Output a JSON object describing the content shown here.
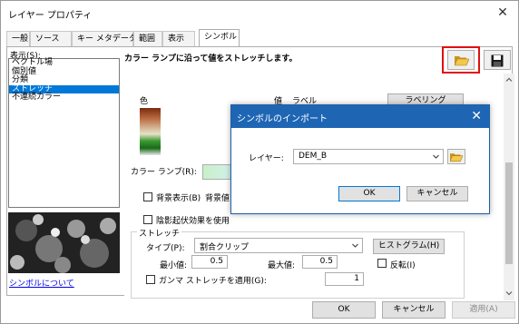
{
  "window": {
    "title": "レイヤー プロパティ",
    "close_glyph": "✕"
  },
  "tabs": [
    {
      "label": "一般"
    },
    {
      "label": "ソース"
    },
    {
      "label": "キー メタデータ"
    },
    {
      "label": "範囲"
    },
    {
      "label": "表示"
    },
    {
      "label": "シンボル"
    }
  ],
  "left": {
    "show_label": "表示(S):",
    "items": [
      "ベクトル場",
      "個別値",
      "分類",
      "ストレッチ",
      "不連続カラー"
    ],
    "selected_index": 3,
    "about_link": "シンボルについて"
  },
  "main": {
    "description": "カラー ランプに沿って値をストレッチします。",
    "import_icon": "folder-open-icon",
    "save_icon": "save-icon",
    "col_color": "色",
    "col_value": "値",
    "col_label": "ラベル",
    "labeling_button": "ラベリング",
    "color_ramp_label": "カラー ランプ(R):",
    "bg_checkbox_label": "背景表示(B)",
    "bg_value_label": "背景値",
    "hillshade_label": "陰影起伏効果を使用",
    "stretch_section": "ストレッチ",
    "type_label": "タイプ(P):",
    "type_value": "割合クリップ",
    "histogram_button": "ヒストグラム(H)",
    "min_label": "最小値:",
    "min_value": "0.5",
    "max_label": "最大値:",
    "max_value": "0.5",
    "invert_label": "反転(I)",
    "gamma_label": "ガンマ ストレッチを適用(G):",
    "gamma_value": "1"
  },
  "footer": {
    "ok": "OK",
    "cancel": "キャンセル",
    "apply": "適用(A)"
  },
  "dialog": {
    "title": "シンボルのインポート",
    "close_glyph": "✕",
    "layer_label": "レイヤー:",
    "layer_value": "DEM_B",
    "ok": "OK",
    "cancel": "キャンセル"
  },
  "colors": {
    "accent": "#0078d7",
    "dialog_title": "#1e66b4",
    "highlight": "#e01010",
    "folder": "#e8b838"
  }
}
